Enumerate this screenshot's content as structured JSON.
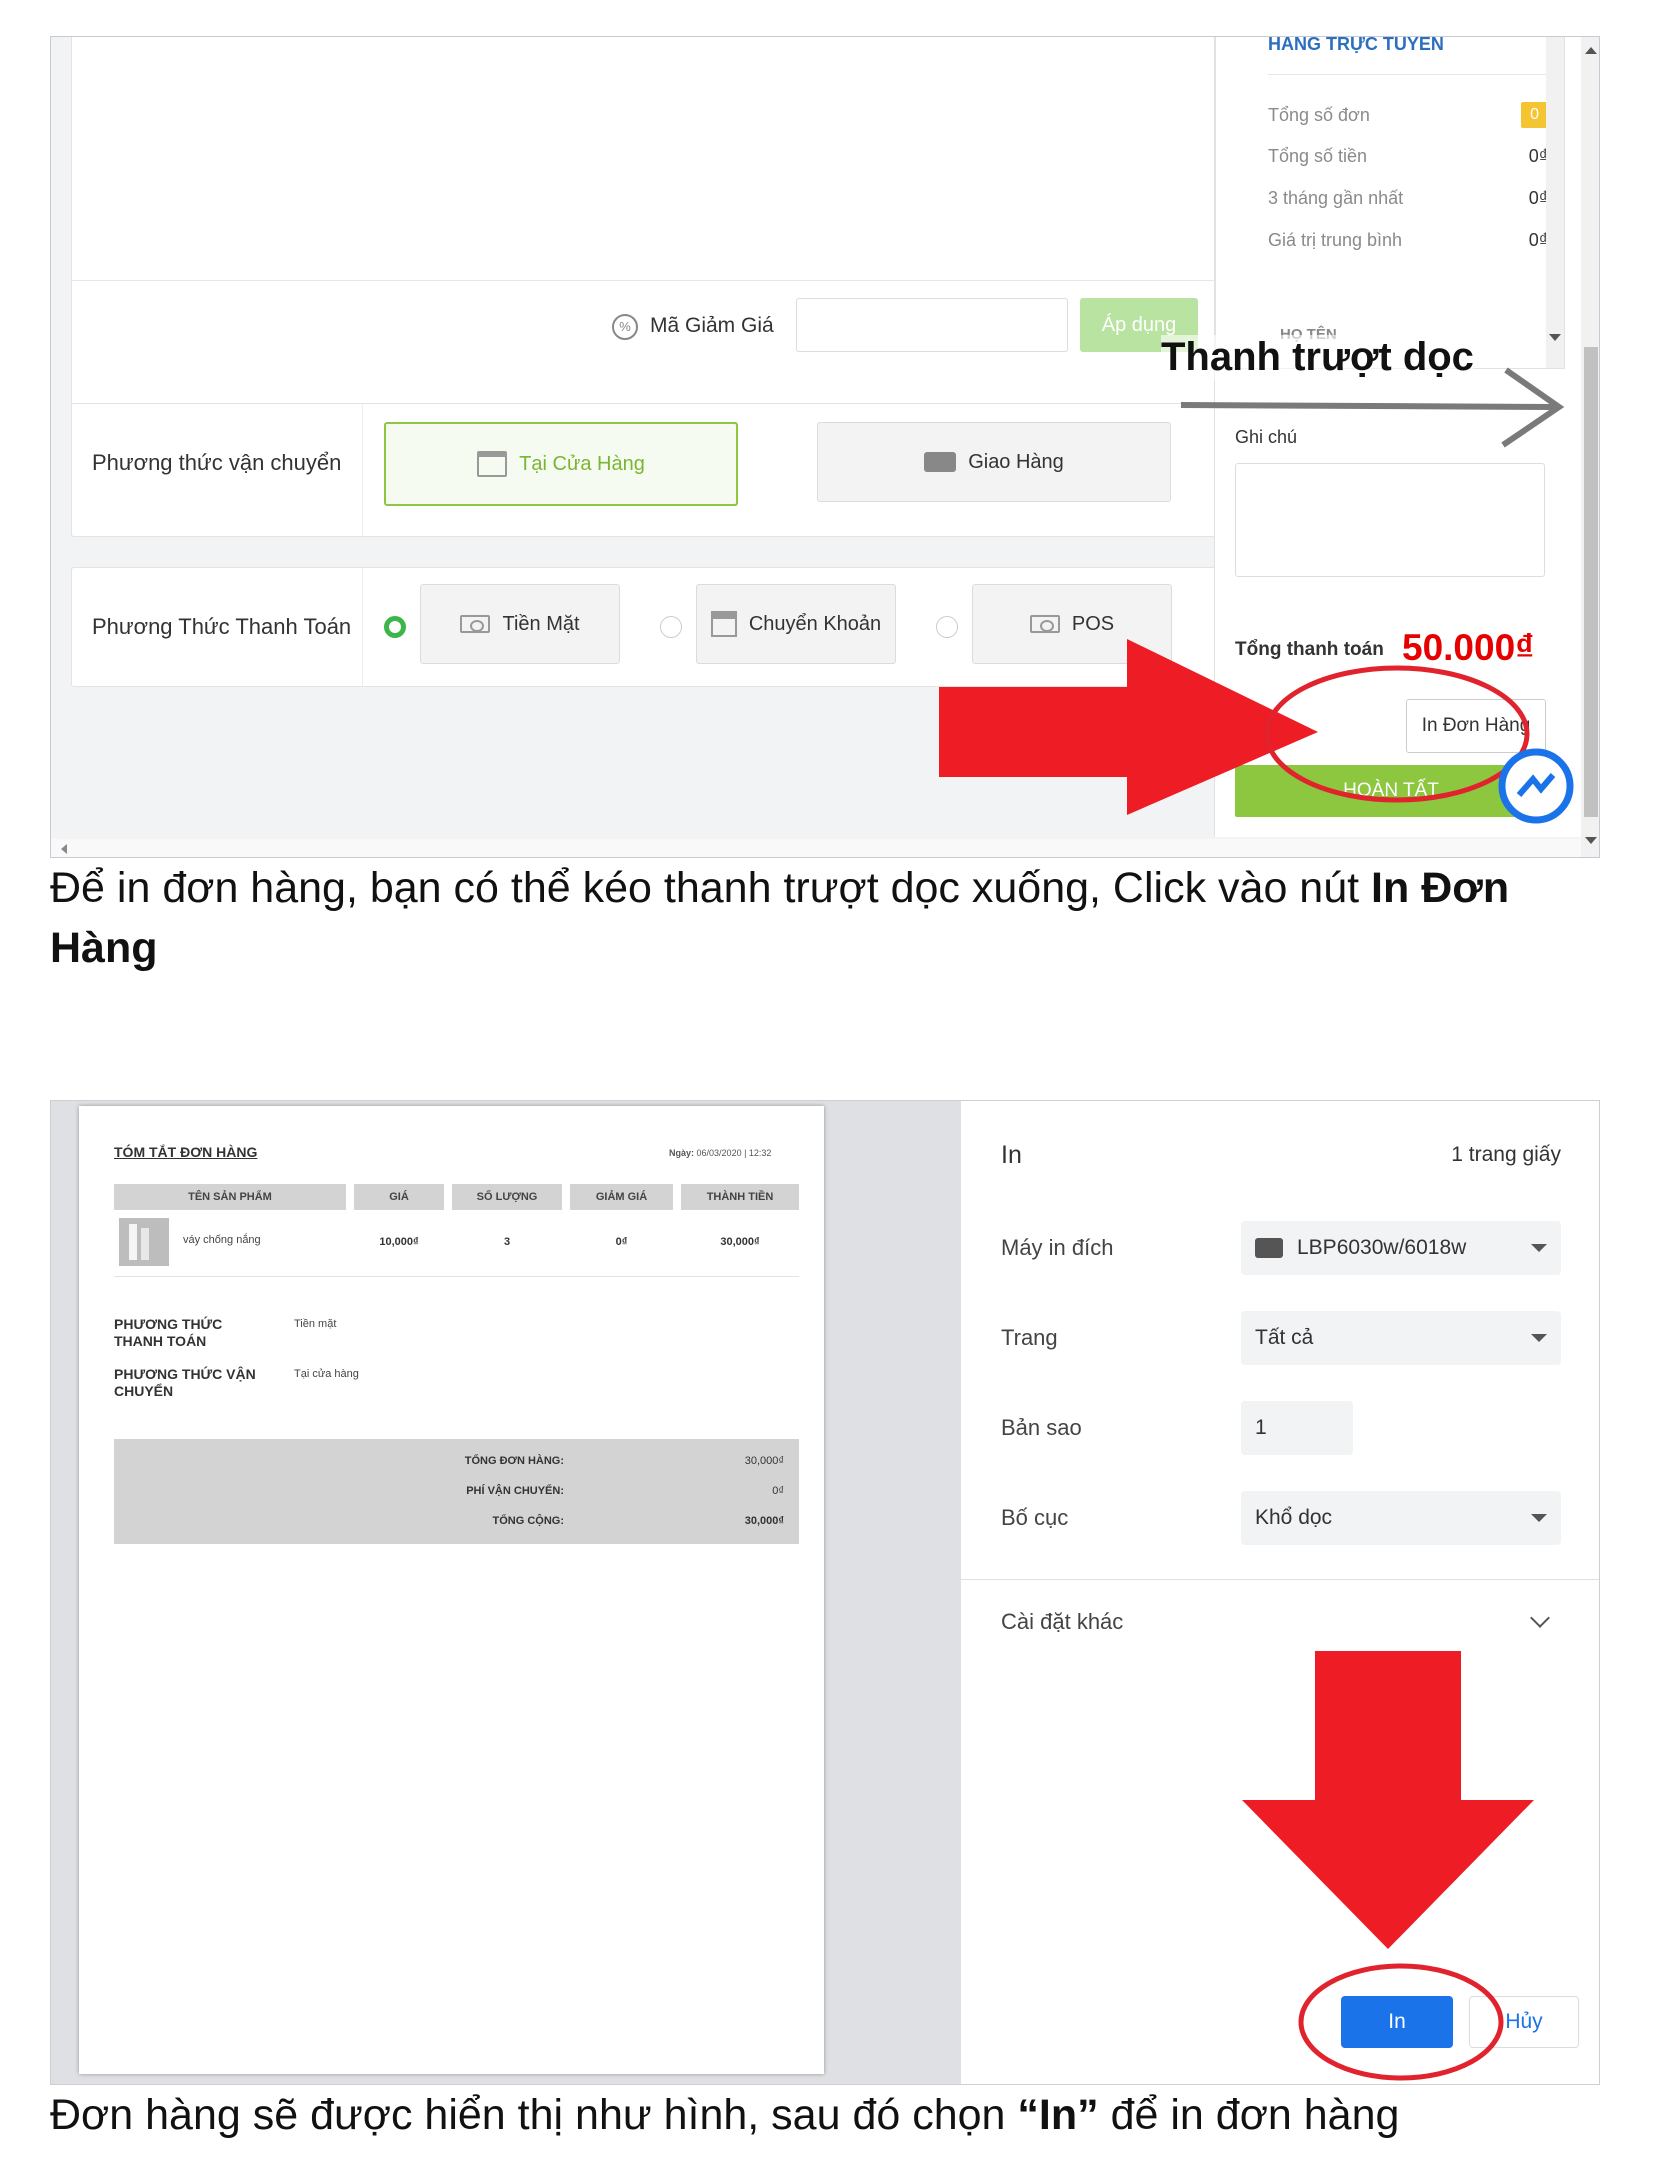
{
  "shot1": {
    "discount": {
      "label": "Mã Giảm Giá",
      "apply_label": "Áp dụng"
    },
    "shipping": {
      "label": "Phương thức vận chuyển",
      "store_label": "Tại Cửa Hàng",
      "delivery_label": "Giao Hàng"
    },
    "payment": {
      "label": "Phương Thức Thanh Toán",
      "options": [
        "Tiền Mặt",
        "Chuyển Khoản",
        "POS"
      ],
      "selected": "Tiền Mặt"
    },
    "stats": {
      "header": "HÀNG TRỰC TUYẾN",
      "rows": [
        {
          "label": "Tổng số đơn",
          "value": "0"
        },
        {
          "label": "Tổng số tiền",
          "value": "0₫"
        },
        {
          "label": "3 tháng gần nhất",
          "value": "0₫"
        },
        {
          "label": "Giá trị trung bình",
          "value": "0₫"
        }
      ],
      "name_header": "HỌ TÊN"
    },
    "annotation": "Thanh trượt dọc",
    "note_label": "Ghi chú",
    "total_label": "Tổng thanh toán",
    "total_value": "50.000₫",
    "print_button": "In Đơn Hàng",
    "finish_button": "HOÀN TẤT",
    "colors": {
      "accent_green": "#8dc63f",
      "total_red": "#e60000",
      "arrow_red": "#ee1c25",
      "link_blue": "#2c6fbf"
    }
  },
  "caption1": {
    "text": "Để in đơn hàng, bạn có thể kéo thanh trượt dọc xuống, Click vào nút ",
    "bold": "In Đơn Hàng"
  },
  "shot2": {
    "receipt": {
      "title": "TÓM TẮT ĐƠN HÀNG",
      "date_label": "Ngày:",
      "date_value": "06/03/2020 | 12:32",
      "columns": [
        "TÊN SẢN PHẨM",
        "GIÁ",
        "SỐ LƯỢNG",
        "GIẢM GIÁ",
        "THÀNH TIỀN"
      ],
      "rows": [
        {
          "name": "váy chống nắng",
          "price": "10,000₫",
          "qty": "3",
          "discount": "0₫",
          "total": "30,000₫"
        }
      ],
      "payment_label": "PHƯƠNG THỨC THANH TOÁN",
      "payment_value": "Tiền mặt",
      "shipping_label": "PHƯƠNG THỨC VẬN CHUYỂN",
      "shipping_value": "Tại cửa hàng",
      "summary": [
        {
          "label": "TỔNG ĐƠN HÀNG:",
          "value": "30,000₫"
        },
        {
          "label": "PHÍ VẬN CHUYỂN:",
          "value": "0₫"
        },
        {
          "label": "TỔNG CỘNG:",
          "value": "30,000₫"
        }
      ]
    },
    "print": {
      "title": "In",
      "pages": "1 trang giấy",
      "printer_label": "Máy in đích",
      "printer_value": "LBP6030w/6018w",
      "pages_label": "Trang",
      "pages_value": "Tất cả",
      "copies_label": "Bản sao",
      "copies_value": "1",
      "layout_label": "Bố cục",
      "layout_value": "Khổ dọc",
      "more_label": "Cài đặt khác",
      "print_button": "In",
      "cancel_button": "Hủy",
      "colors": {
        "primary_blue": "#1a73e8"
      }
    }
  },
  "caption2": {
    "before": "Đơn hàng sẽ được hiển thị như hình, sau đó chọn ",
    "bold": "“In”",
    "after": " để in đơn hàng"
  }
}
